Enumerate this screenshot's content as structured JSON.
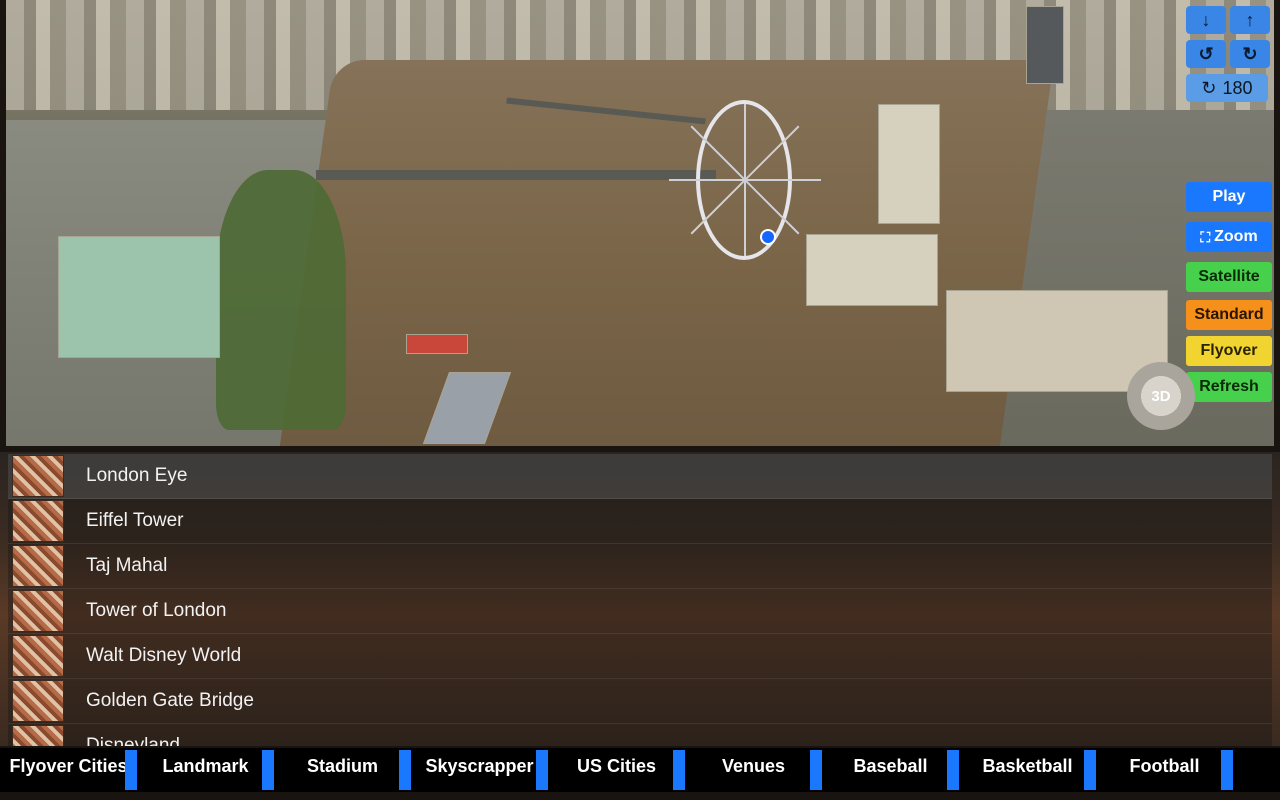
{
  "map_controls": {
    "arrow_down_icon": "↓",
    "arrow_up_icon": "↑",
    "rotate_left_icon": "↺",
    "rotate_right_icon": "↻",
    "rotate_refresh_icon": "↻",
    "rotation_value": "180",
    "zoom_icon": "⛶",
    "compass_label": "3D"
  },
  "buttons": {
    "play": "Play",
    "zoom": "Zoom",
    "satellite": "Satellite",
    "standard": "Standard",
    "flyover": "Flyover",
    "refresh": "Refresh"
  },
  "locations": [
    {
      "name": "London Eye"
    },
    {
      "name": "Eiffel Tower"
    },
    {
      "name": "Taj Mahal"
    },
    {
      "name": "Tower of London"
    },
    {
      "name": "Walt Disney World"
    },
    {
      "name": "Golden Gate Bridge"
    },
    {
      "name": "Disneyland"
    }
  ],
  "tabs": [
    {
      "label": "Flyover Cities"
    },
    {
      "label": "Landmark"
    },
    {
      "label": "Stadium"
    },
    {
      "label": "Skyscrapper"
    },
    {
      "label": "US Cities"
    },
    {
      "label": "Venues"
    },
    {
      "label": "Baseball"
    },
    {
      "label": "Basketball"
    },
    {
      "label": "Football"
    }
  ],
  "colors": {
    "accent_blue": "#1a78ff",
    "satellite_green": "#46d04c",
    "standard_orange": "#f5901a",
    "flyover_yellow": "#f2d431"
  }
}
